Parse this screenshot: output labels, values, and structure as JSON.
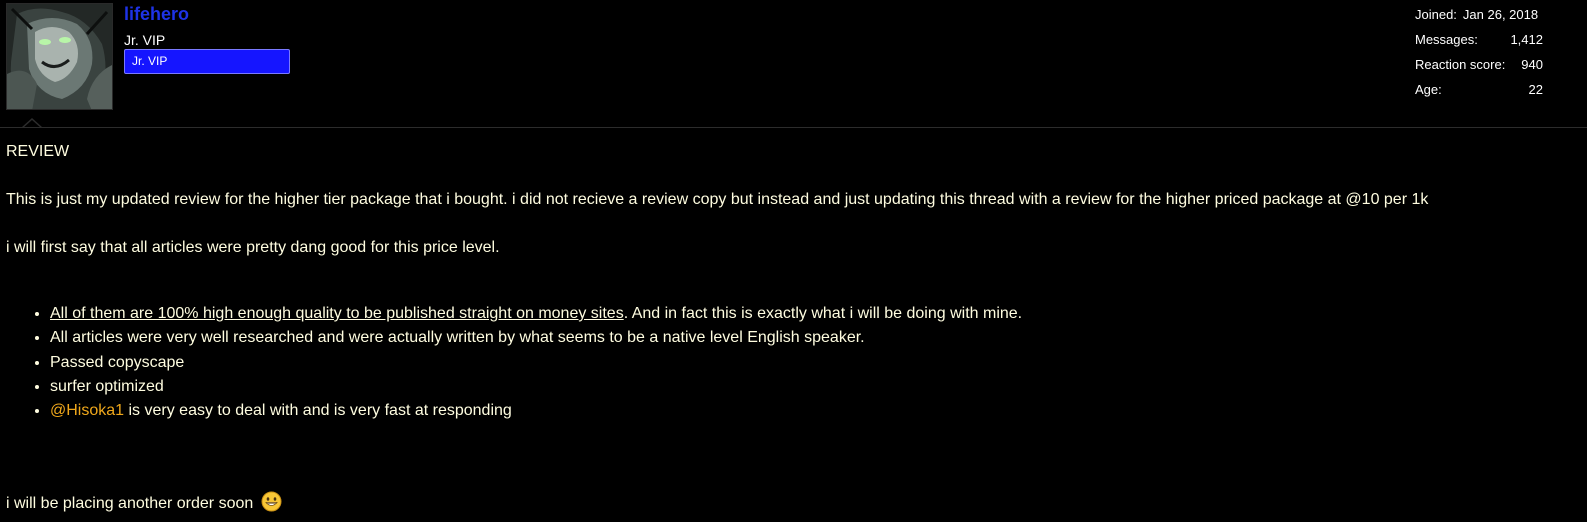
{
  "user": {
    "username": "lifehero",
    "title": "Jr. VIP",
    "banner": "Jr. VIP",
    "avatar_icon": "avatar-image"
  },
  "stats": {
    "joined_label": "Joined:",
    "joined_value": "Jan 26, 2018",
    "messages_label": "Messages:",
    "messages_value": "1,412",
    "reaction_label": "Reaction score:",
    "reaction_value": "940",
    "age_label": "Age:",
    "age_value": "22"
  },
  "post": {
    "heading": "REVIEW",
    "paragraph1": "This is just my updated review for the higher tier package that i bought. i did not recieve a review copy but instead and just updating this thread with a review for the higher priced package at @10 per 1k",
    "paragraph2": "i will first say that all articles were pretty dang good for this price level.",
    "bullets": {
      "b1_underlined": "All of them are 100% high enough quality to be published straight on money sites",
      "b1_rest": ". And in fact this is exactly what i will be doing with mine.",
      "b2": "All articles were very well researched and were actually written by what seems to be a native level English speaker.",
      "b3": "Passed copyscape",
      "b4": "surfer optimized",
      "b5_mention": "@Hisoka1",
      "b5_rest": " is very easy to deal with and is very fast at responding"
    },
    "closing": "i will be placing another order soon",
    "closing_emoji": "grin-emoji"
  },
  "colors": {
    "background": "#000000",
    "username": "#1e33e6",
    "banner": "#1515ff",
    "body_text": "#fffde0",
    "mention": "#f0a81b"
  }
}
